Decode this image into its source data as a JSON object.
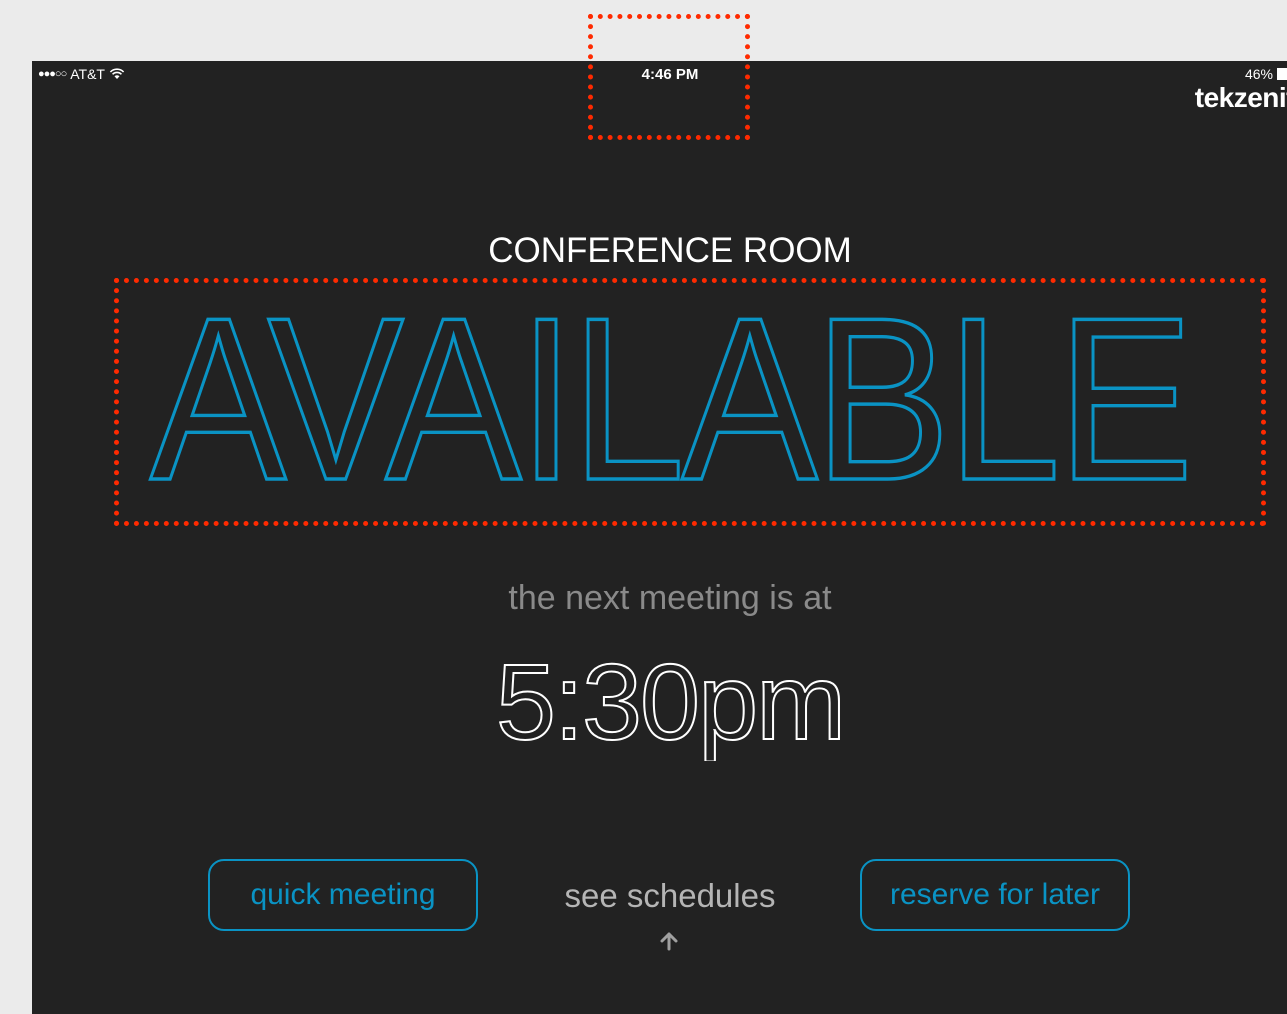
{
  "status_bar": {
    "carrier": "AT&T",
    "time": "4:46 PM",
    "battery": "46%"
  },
  "brand": {
    "logo_text": "tekzenit"
  },
  "room": {
    "name": "CONFERENCE ROOM",
    "status": "AVAILABLE",
    "status_color": "#0a93c4"
  },
  "next_meeting": {
    "label": "the next meeting is at",
    "time": "5:30pm"
  },
  "actions": {
    "quick_meeting": "quick meeting",
    "see_schedules": "see schedules",
    "reserve_for_later": "reserve for later"
  },
  "icons": {
    "wifi": "wifi-icon",
    "battery": "battery-icon",
    "arrow": "arrow-up-icon"
  },
  "annotation_color": "#ff2a00"
}
